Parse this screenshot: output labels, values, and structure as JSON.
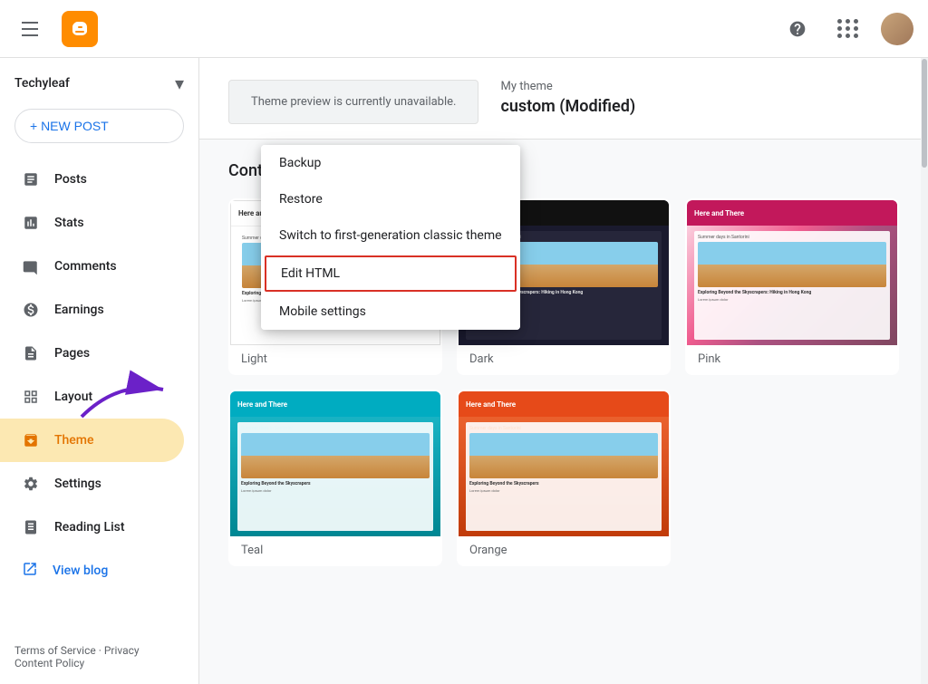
{
  "topbar": {
    "blog_name": "Techyleaf",
    "hamburger_label": "Menu"
  },
  "sidebar": {
    "blog_name": "Techyleaf",
    "new_post_label": "+ NEW POST",
    "items": [
      {
        "id": "posts",
        "label": "Posts",
        "icon": "posts-icon"
      },
      {
        "id": "stats",
        "label": "Stats",
        "icon": "stats-icon"
      },
      {
        "id": "comments",
        "label": "Comments",
        "icon": "comments-icon"
      },
      {
        "id": "earnings",
        "label": "Earnings",
        "icon": "earnings-icon"
      },
      {
        "id": "pages",
        "label": "Pages",
        "icon": "pages-icon"
      },
      {
        "id": "layout",
        "label": "Layout",
        "icon": "layout-icon"
      },
      {
        "id": "theme",
        "label": "Theme",
        "icon": "theme-icon",
        "active": true
      },
      {
        "id": "settings",
        "label": "Settings",
        "icon": "settings-icon"
      },
      {
        "id": "reading-list",
        "label": "Reading List",
        "icon": "reading-list-icon"
      }
    ],
    "view_blog_label": "View blog",
    "footer_links": [
      "Terms of Service",
      "Privacy",
      "Content Policy"
    ]
  },
  "theme_page": {
    "preview_unavailable_text": "Theme preview is currently unavailable.",
    "my_theme_label": "My theme",
    "my_theme_name": "custom (Modified)",
    "content_section_title": "Conte"
  },
  "dropdown": {
    "items": [
      {
        "id": "backup",
        "label": "Backup",
        "highlighted": false
      },
      {
        "id": "restore",
        "label": "Restore",
        "highlighted": false
      },
      {
        "id": "switch-classic",
        "label": "Switch to first-generation classic theme",
        "highlighted": false
      },
      {
        "id": "edit-html",
        "label": "Edit HTML",
        "highlighted": true
      },
      {
        "id": "mobile-settings",
        "label": "Mobile settings",
        "highlighted": false
      }
    ]
  },
  "themes": {
    "grid_items": [
      {
        "id": "light",
        "label": "Light",
        "style": "light"
      },
      {
        "id": "dark",
        "label": "Dark",
        "style": "dark"
      },
      {
        "id": "pink",
        "label": "Pink",
        "style": "pink"
      },
      {
        "id": "teal",
        "label": "Teal",
        "style": "teal"
      },
      {
        "id": "orange",
        "label": "Orange",
        "style": "orange"
      }
    ]
  }
}
